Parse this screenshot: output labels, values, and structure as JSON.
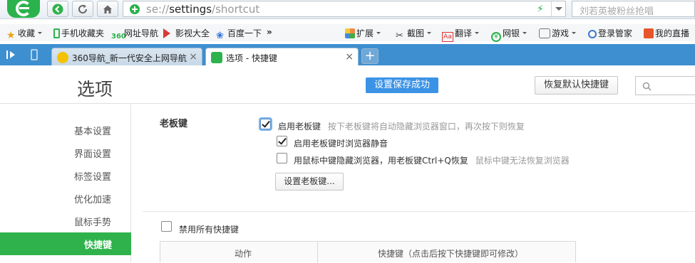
{
  "address_bar": {
    "url_prefix": "se://",
    "url_host": "settings",
    "url_path": "/shortcut",
    "search_placeholder": "刘若英被粉丝抢唱"
  },
  "bookmarks": [
    {
      "label": "收藏",
      "icon": "star-icon",
      "dropdown": true
    },
    {
      "label": "手机收藏夹",
      "icon": "phone-icon"
    },
    {
      "label": "网址导航",
      "icon": "nav-icon"
    },
    {
      "label": "影视大全",
      "icon": "video-icon"
    },
    {
      "label": "百度一下",
      "icon": "baidu-icon"
    },
    {
      "label": "»",
      "icon": ""
    }
  ],
  "extensions": [
    {
      "label": "扩展",
      "icon": "extension-icon"
    },
    {
      "label": "截图",
      "icon": "screenshot-icon"
    },
    {
      "label": "翻译",
      "icon": "translate-icon"
    },
    {
      "label": "网银",
      "icon": "bank-icon"
    },
    {
      "label": "游戏",
      "icon": "game-icon"
    },
    {
      "label": "登录管家",
      "icon": "login-icon"
    },
    {
      "label": "我的直播",
      "icon": "live-icon"
    }
  ],
  "tabs": [
    {
      "title": "360导航_新一代安全上网导航",
      "close": "×"
    },
    {
      "title": "选项 - 快捷键",
      "close": "×"
    }
  ],
  "new_tab": "+",
  "page": {
    "title": "选项",
    "toast": "设置保存成功",
    "restore_button": "恢复默认快捷键"
  },
  "sidebar": {
    "items": [
      {
        "label": "基本设置"
      },
      {
        "label": "界面设置"
      },
      {
        "label": "标签设置"
      },
      {
        "label": "优化加速"
      },
      {
        "label": "鼠标手势"
      },
      {
        "label": "快捷键"
      }
    ],
    "active": "快捷键"
  },
  "boss_key": {
    "section_title": "老板键",
    "enable_label": "启用老板键",
    "enable_hint": "按下老板键将自动隐藏浏览器窗口，再次按下则恢复",
    "enable_checked": true,
    "mute_label": "启用老板键时浏览器静音",
    "mute_checked": true,
    "middle_label": "用鼠标中键隐藏浏览器，用老板键Ctrl+Q恢复",
    "middle_hint": "鼠标中键无法恢复浏览器",
    "middle_checked": false,
    "set_button": "设置老板键..."
  },
  "shortcuts": {
    "disable_all_label": "禁用所有快捷键",
    "disable_all_checked": false,
    "col_action": "动作",
    "col_shortcut": "快捷键（点击后按下快捷键即可修改）"
  },
  "colors": {
    "accent_green": "#2fb24c",
    "tab_blue": "#3d8fd0",
    "toast_blue": "#3b93e6"
  }
}
